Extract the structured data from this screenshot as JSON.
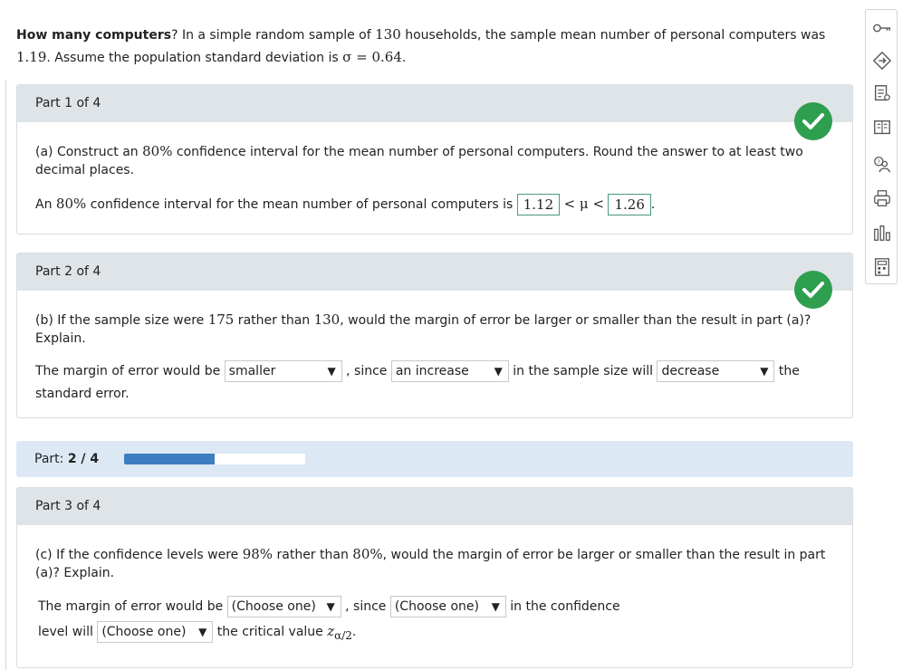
{
  "question": {
    "bold": "How many computers",
    "text": "? In a simple random sample of ",
    "n": "130",
    "text2": " households, the sample mean number of personal computers was",
    "mean": "1.19",
    "text3": ". Assume the population standard deviation is ",
    "sigma": "σ = 0.64",
    "end": "."
  },
  "part1": {
    "header": "Part 1 of 4",
    "prompt_a": "(a) Construct an ",
    "conf": "80%",
    "prompt_b": " confidence interval for the mean number of personal computers. Round the answer to at least two decimal places.",
    "answer_a": "An ",
    "answer_b": " confidence interval for the mean number of personal computers is ",
    "lower": "1.12",
    "lt_mu_lt": "< μ <",
    "upper": "1.26",
    "period": "."
  },
  "part2": {
    "header": "Part 2 of 4",
    "prompt_a": "(b) If the sample size were ",
    "n_new": "175",
    "prompt_b": " rather than ",
    "n_old": "130",
    "prompt_c": ", would the margin of error be larger or smaller than the result in part (a)? Explain.",
    "line_a": "The margin of error would be ",
    "dd1": "smaller",
    "line_b": ", since ",
    "dd2": "an increase",
    "line_c": " in the sample size will ",
    "dd3": "decrease",
    "line_d": " the",
    "line_e": "standard error."
  },
  "progress": {
    "label": "Part: ",
    "value": "2 / 4",
    "fraction": 0.5
  },
  "part3": {
    "header": "Part 3 of 4",
    "prompt_a": "(c) If the confidence levels were ",
    "c_new": "98%",
    "prompt_b": " rather than ",
    "c_old": "80%",
    "prompt_c": ", would the margin of error be larger or smaller than the result in part (a)? Explain.",
    "line_a": "The margin of error would be ",
    "dd1": "(Choose one)",
    "line_b": ", since ",
    "dd2": "(Choose one)",
    "line_c": " in the confidence",
    "line_d": "level will ",
    "dd3": "(Choose one)",
    "line_e": " the critical value ",
    "z": "z",
    "z_sub": "α/2",
    "line_f": "."
  },
  "toolbar": {
    "icons": [
      "key-icon",
      "hint-icon",
      "notes-icon",
      "book-icon",
      "help-icon",
      "print-icon",
      "chart-icon",
      "calculator-icon"
    ]
  },
  "colors": {
    "check": "#2e9e4f",
    "progress_fill": "#3d7ec0",
    "part_header": "#dfe4e8",
    "answer_border": "#4a9a77"
  }
}
